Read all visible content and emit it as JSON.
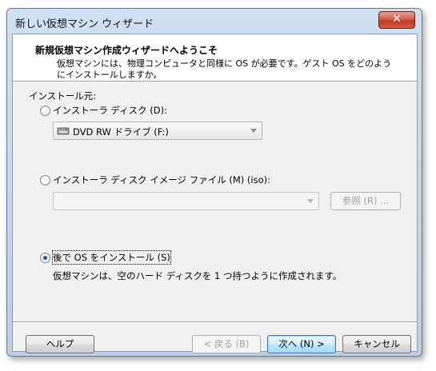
{
  "window": {
    "title": "新しい仮想マシン ウィザード",
    "close_label": "✕"
  },
  "header": {
    "title": "新規仮想マシン作成ウィザードへようこそ",
    "description": "仮想マシンには、物理コンピュータと同様に OS が必要です。ゲスト OS をどのようにインストールしますか。"
  },
  "install_source": {
    "group_label": "インストール元:",
    "options": [
      {
        "label": "インストーラ ディスク (D):",
        "selected": false
      },
      {
        "label": "インストーラ ディスク イメージ ファイル (M) (iso):",
        "selected": false
      },
      {
        "label": "後で OS をインストール (S)",
        "selected": true
      }
    ],
    "disc_drive": {
      "value": "DVD RW ドライブ (F:)",
      "icon": "dvd-drive-icon"
    },
    "iso_path": {
      "value": ""
    },
    "browse_label": "参照 (R) ...",
    "later_description": "仮想マシンは、空のハード ディスクを 1 つ持つように作成されます。"
  },
  "footer": {
    "help_label": "ヘルプ",
    "back_label": "< 戻る (B)",
    "next_label": "次へ (N) >",
    "cancel_label": "キャンセル"
  },
  "colors": {
    "selected_radio": "#1f4fa1",
    "default_button_border": "#3c7fb1",
    "close_button": "#c9442c"
  }
}
